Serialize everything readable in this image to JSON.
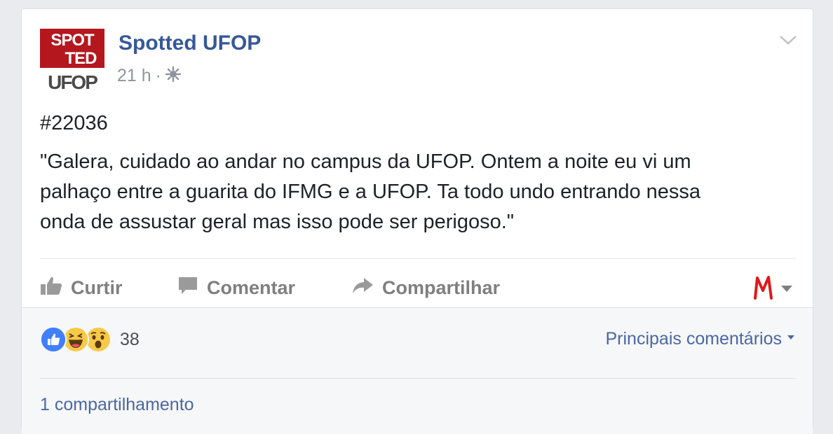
{
  "post": {
    "page_name": "Spotted UFOP",
    "timestamp": "21 h",
    "separator": "·",
    "privacy_icon": "globe-icon",
    "avatar": {
      "line1": "SPOT",
      "line2": "TED",
      "line3": "UFOP",
      "colors": {
        "red": "#b5171e",
        "gray": "#4a4a4a"
      }
    },
    "menu_icon": "chevron-down-icon",
    "tag": "#22036",
    "text_lines": [
      "\"Galera, cuidado ao andar no campus da UFOP. Ontem a noite eu vi um",
      "palhaço entre a guarita do IFMG e a UFOP. Ta todo undo entrando nessa",
      "onda de assustar geral mas isso pode ser perigoso.\""
    ]
  },
  "actions": {
    "like": {
      "label": "Curtir",
      "icon": "thumbs-up-icon"
    },
    "comment": {
      "label": "Comentar",
      "icon": "comment-icon"
    },
    "share": {
      "label": "Compartilhar",
      "icon": "share-arrow-icon"
    },
    "reader_icon": "m-logo-icon",
    "reader_color": "#e0191b"
  },
  "footer": {
    "reactions": [
      "like-reaction-icon",
      "haha-reaction-icon",
      "wow-reaction-icon"
    ],
    "reaction_count": "38",
    "sort_label": "Principais comentários",
    "shares_label": "1 compartilhamento"
  },
  "colors": {
    "link_blue": "#365899",
    "meta_gray": "#90949c",
    "text": "#1d2129",
    "footer_bg": "#f6f7f9",
    "like_blue": "#4080ff",
    "emoji_yellow": "#f7c948"
  }
}
